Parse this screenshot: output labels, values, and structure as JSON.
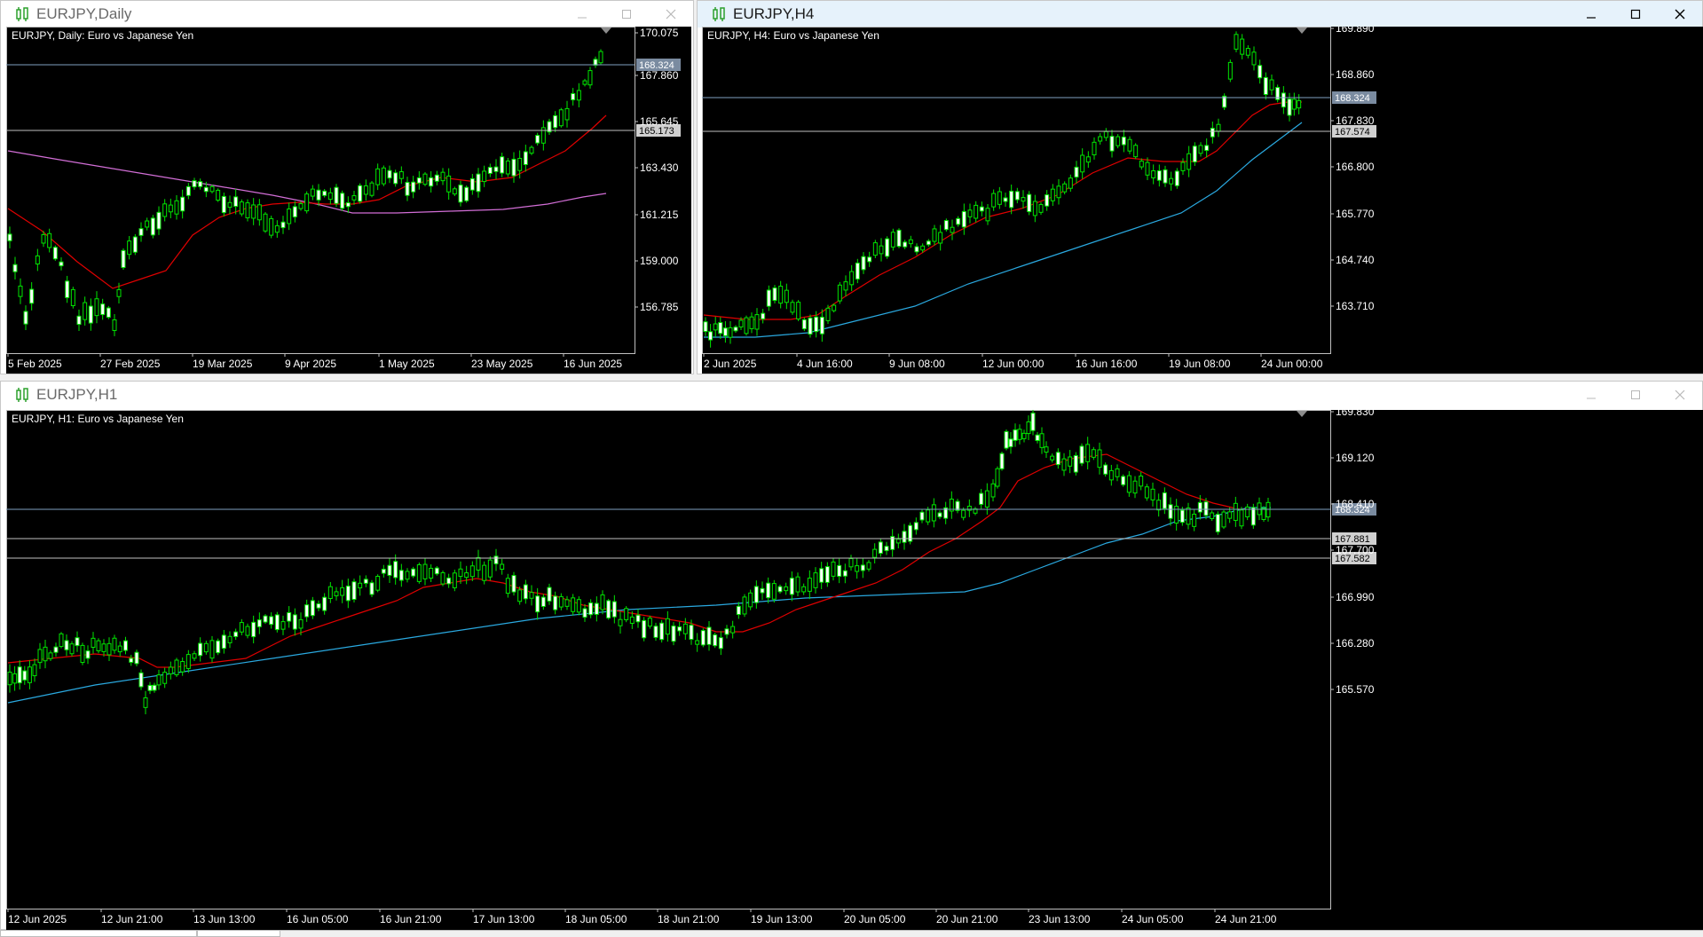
{
  "colors": {
    "chart_bg": "#000000",
    "candle": "#00e600",
    "ma_red": "#e00000",
    "ma_blue": "#2aa9e0",
    "ma_pink": "#d26ed6",
    "price_line": "#7f9fbf",
    "hline": "#c0c0c0",
    "axis_text": "#ffffff",
    "price_tag_bg": "#7a8ba0"
  },
  "windows": [
    {
      "id": "daily",
      "title": "EURJPY,Daily",
      "active": false,
      "caption": "EURJPY, Daily:  Euro vs Japanese Yen",
      "y_ticks": [
        "170.075",
        "167.860",
        "165.645",
        "163.430",
        "161.215",
        "159.000",
        "156.785"
      ],
      "x_ticks": [
        "5 Feb 2025",
        "27 Feb 2025",
        "19 Mar 2025",
        "9 Apr 2025",
        "1 May 2025",
        "23 May 2025",
        "16 Jun 2025"
      ],
      "price_tags": [
        {
          "label": "168.324",
          "kind": "bid"
        },
        {
          "label": "165.173",
          "kind": "line"
        }
      ]
    },
    {
      "id": "h4",
      "title": "EURJPY,H4",
      "active": true,
      "caption": "EURJPY, H4:  Euro vs Japanese Yen",
      "y_ticks": [
        "169.890",
        "168.860",
        "167.830",
        "166.800",
        "165.770",
        "164.740",
        "163.710"
      ],
      "x_ticks": [
        "2 Jun 2025",
        "4 Jun 16:00",
        "9 Jun 08:00",
        "12 Jun 00:00",
        "16 Jun 16:00",
        "19 Jun 08:00",
        "24 Jun 00:00"
      ],
      "price_tags": [
        {
          "label": "168.324",
          "kind": "bid"
        },
        {
          "label": "167.574",
          "kind": "line"
        }
      ]
    },
    {
      "id": "h1",
      "title": "EURJPY,H1",
      "active": false,
      "caption": "EURJPY, H1:  Euro vs Japanese Yen",
      "y_ticks": [
        "169.830",
        "169.120",
        "168.410",
        "167.700",
        "166.990",
        "166.280",
        "165.570"
      ],
      "x_ticks": [
        "12 Jun 2025",
        "12 Jun 21:00",
        "13 Jun 13:00",
        "16 Jun 05:00",
        "16 Jun 21:00",
        "17 Jun 13:00",
        "18 Jun 05:00",
        "18 Jun 21:00",
        "19 Jun 13:00",
        "20 Jun 05:00",
        "20 Jun 21:00",
        "23 Jun 13:00",
        "24 Jun 05:00",
        "24 Jun 21:00"
      ],
      "price_tags": [
        {
          "label": "168.324",
          "kind": "bid"
        },
        {
          "label": "167.881",
          "kind": "line"
        },
        {
          "label": "167.582",
          "kind": "line"
        }
      ]
    }
  ]
}
